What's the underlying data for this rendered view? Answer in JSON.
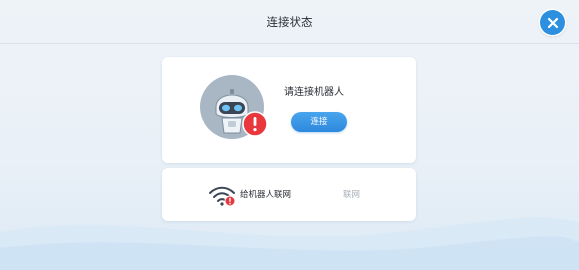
{
  "header": {
    "title": "连接状态"
  },
  "robot_card": {
    "prompt": "请连接机器人",
    "connect_label": "连接"
  },
  "wifi_card": {
    "label": "给机器人联网",
    "action_label": "联网"
  },
  "colors": {
    "accent": "#2d8fdf",
    "warning": "#e8383d",
    "background": "#eef3f8",
    "disabled_text": "#a8b0b9"
  },
  "icons": {
    "close": "close-icon",
    "robot": "robot-avatar-icon",
    "warning": "warning-badge-icon",
    "wifi": "wifi-icon"
  }
}
